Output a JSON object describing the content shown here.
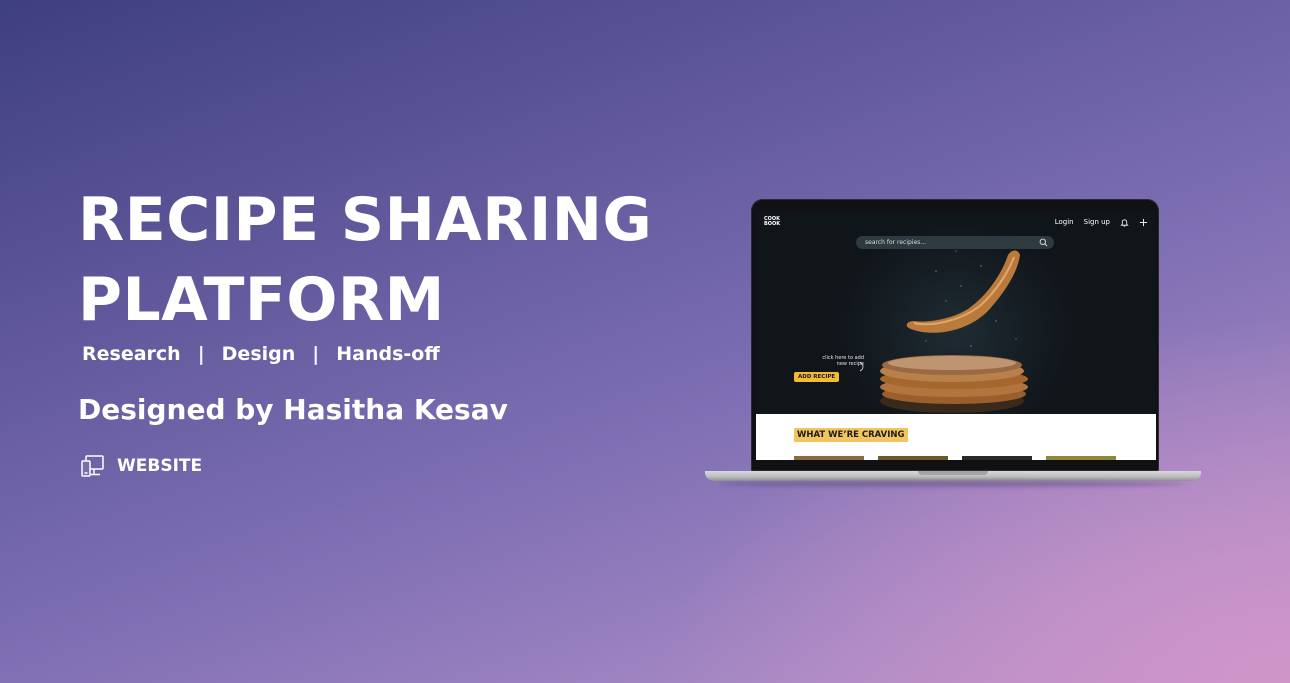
{
  "hero": {
    "title_line1": "RECIPE SHARING",
    "title_line2": "PLATFORM",
    "tags": [
      "Research",
      "Design",
      "Hands-off"
    ],
    "separator": "|",
    "byline": "Designed by Hasitha Kesav",
    "platform_label": "WEBSITE",
    "platform_icon": "devices-icon"
  },
  "mockup": {
    "logo": "COOK BOOK",
    "nav": {
      "login": "Login",
      "signup": "Sign up",
      "icons": [
        "bell-icon",
        "plus-icon"
      ]
    },
    "search_placeholder": "search for recipies...",
    "helper_text": "click here to add new recipe",
    "add_button": "ADD RECIPE",
    "section_heading": "WHAT WE’RE CRAVING"
  },
  "colors": {
    "accent": "#f2bb35",
    "background_start": "#3e3f80",
    "background_end": "#cf95c9"
  }
}
